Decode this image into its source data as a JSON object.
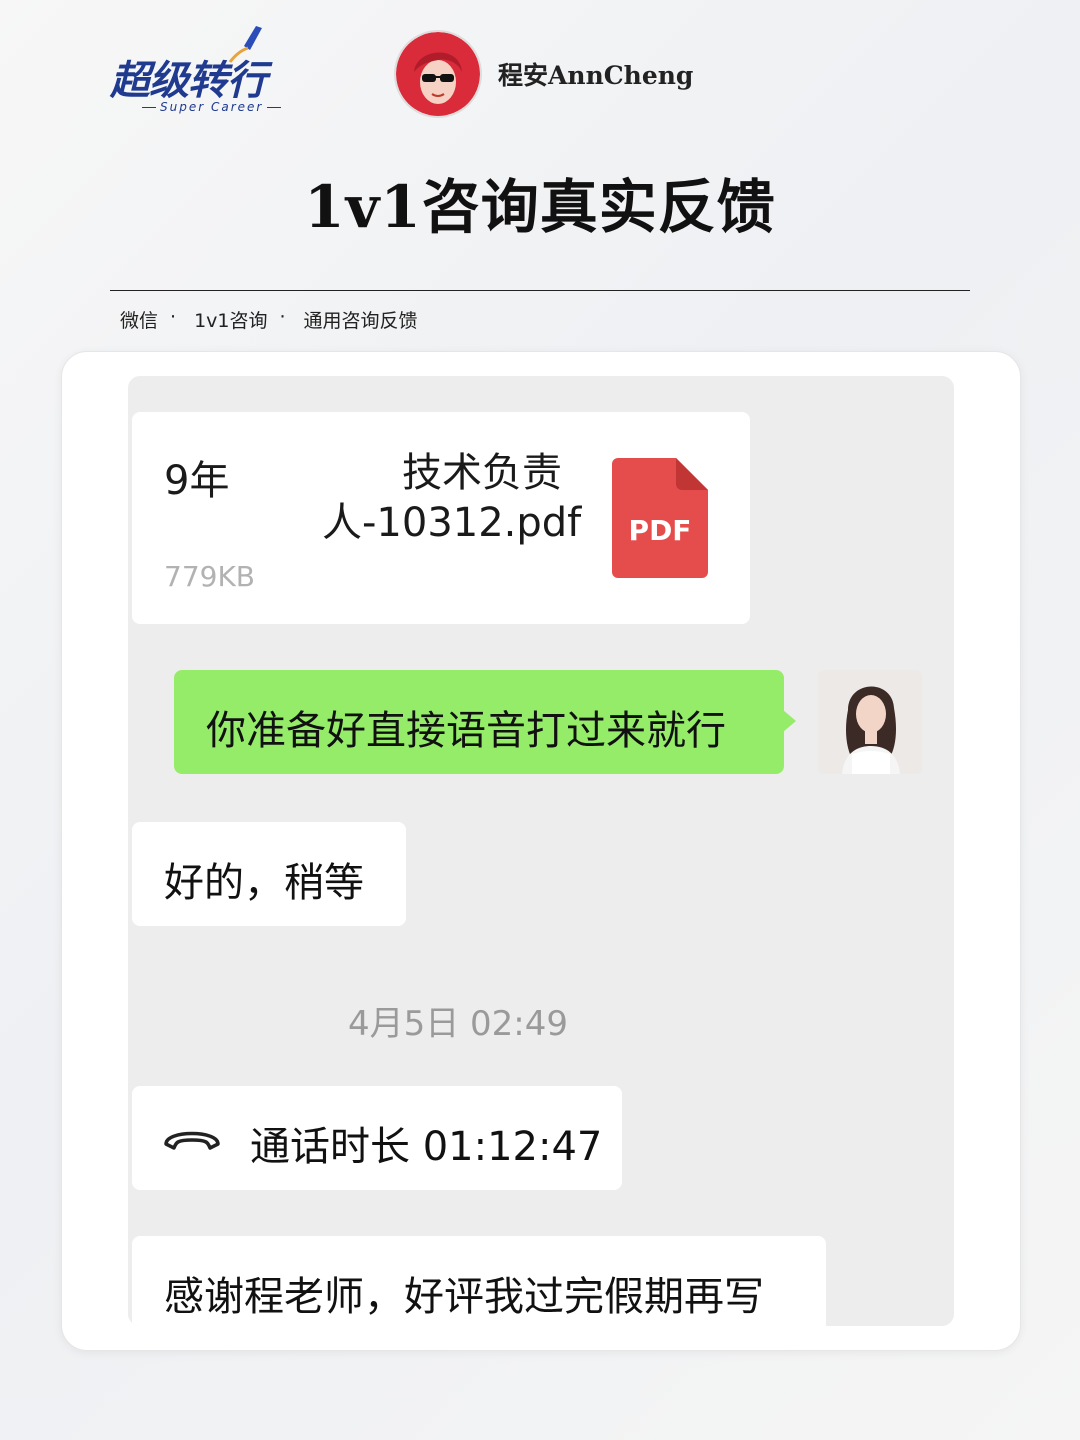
{
  "brand": {
    "logo_text": "超级转行",
    "logo_subtext": "Super Career",
    "author_name": "程安AnnCheng"
  },
  "page": {
    "title": "1v1咨询真实反馈"
  },
  "breadcrumb": [
    {
      "label": "微信",
      "sep": "·"
    },
    {
      "label": "1v1咨询",
      "sep": "·"
    },
    {
      "label": "通用咨询反馈",
      "sep": ""
    }
  ],
  "chat": {
    "file_message": {
      "name_part1": "9年",
      "name_part2": "技术负责人-10312.pdf",
      "size": "779KB",
      "type_label": "PDF",
      "icon": "pdf-file-icon",
      "icon_color": "#e54d4d"
    },
    "sent_message": {
      "text": "你准备好直接语音打过来就行",
      "bubble_color": "#95ec69"
    },
    "received_reply": {
      "text": "好的，稍等"
    },
    "timestamp": "4月5日 02:49",
    "call_record": {
      "icon": "phone-hangup-icon",
      "text": "通话时长 01:12:47"
    },
    "thanks_message": {
      "text": "感谢程老师，好评我过完假期再写"
    }
  }
}
